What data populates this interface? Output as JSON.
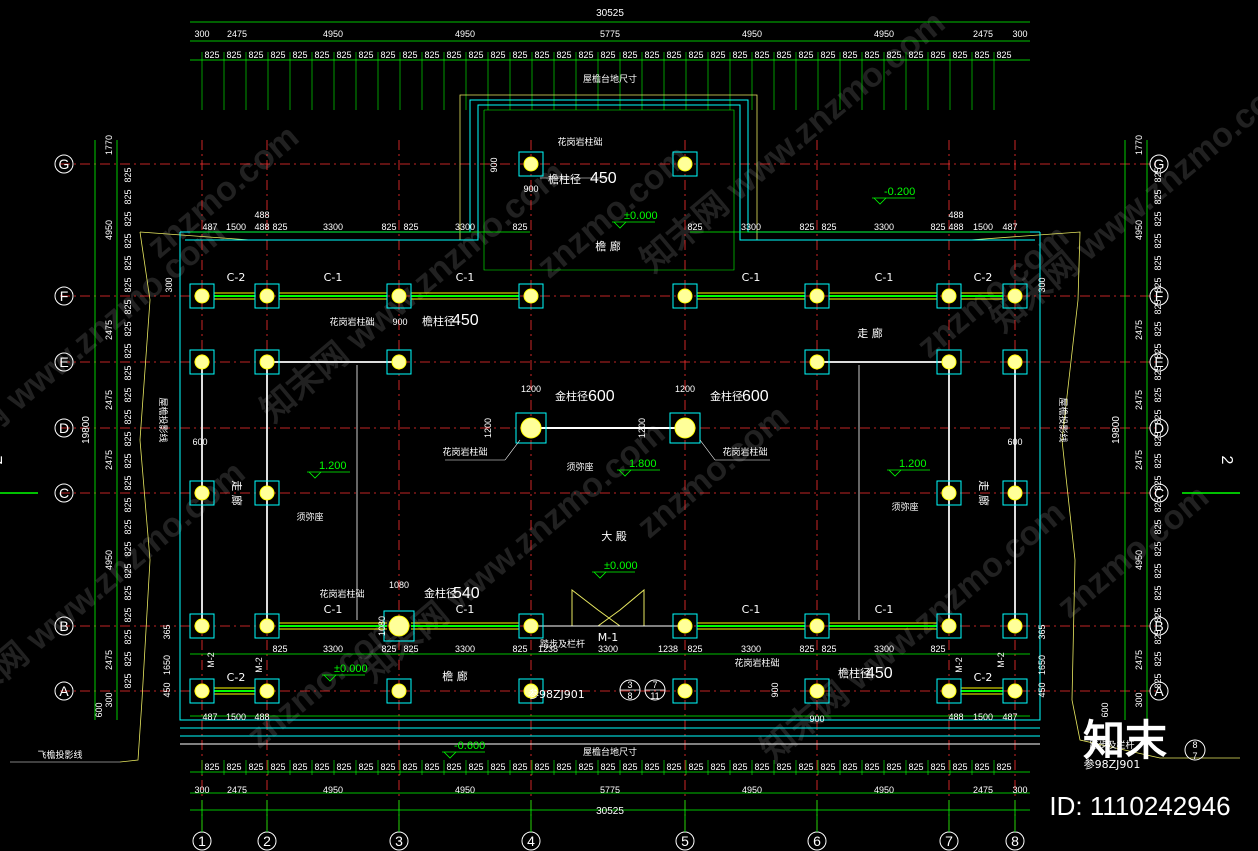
{
  "grid_cols": [
    "1",
    "2",
    "3",
    "4",
    "5",
    "6",
    "7",
    "8"
  ],
  "grid_rows": [
    "G",
    "F",
    "E",
    "D",
    "C",
    "B",
    "A"
  ],
  "dims": {
    "overall": "30525",
    "top_bays": [
      "300",
      "2475",
      "4950",
      "4950",
      "5775",
      "4950",
      "4950",
      "2475",
      "300"
    ],
    "module": "825",
    "left_total": "19800",
    "right_total": "19800",
    "left_rows": [
      "1770",
      "825",
      "4950",
      "825",
      "2475",
      "2475",
      "2475",
      "4950",
      "2475",
      "300",
      "600"
    ],
    "front_rooms": [
      "487",
      "1500",
      "488",
      "825",
      "3300",
      "825",
      "825",
      "3300",
      "825"
    ],
    "bottom_doors": [
      "825",
      "3300",
      "825",
      "825",
      "3300",
      "825",
      "1238",
      "3300",
      "1238",
      "825",
      "3300",
      "825",
      "825",
      "3300",
      "825"
    ],
    "side_small": [
      "365",
      "1650",
      "450",
      "600",
      "300"
    ],
    "col_small": [
      "900",
      "900",
      "1200",
      "1200",
      "1200",
      "1200",
      "1080",
      "1080",
      "900",
      "900"
    ]
  },
  "labels": {
    "column_base_1": "花岗岩柱础",
    "eave_col": "檐柱径",
    "eave_col_size": "450",
    "gold_col": "金柱径",
    "gold_col_size_600": "600",
    "gold_col_size_540": "540",
    "corridor": "走  廊",
    "front_corridor": "檐    廊",
    "hall": "大    殿",
    "altar": "须弥座",
    "window_c1": "C-1",
    "window_c2": "C-2",
    "door_m1": "M-1",
    "door_m2": "M-2",
    "step_ref": "踏步及栏杆",
    "std_ref": "98ZJ901",
    "std_ref_full": "参98ZJ901",
    "roof_outline": "屋檐投影线",
    "roof_line_label": "飞檐投影线",
    "upper_axis": "屋檐台地尺寸",
    "section_mark": "2",
    "detail_nums": [
      "3",
      "7",
      "8",
      "11"
    ]
  },
  "elevations": {
    "e0": "±0.000",
    "e1": "±0.000",
    "e2": "±0.000",
    "e_m200": "-0.200",
    "e_m600": "-0.600",
    "e1200a": "1.200",
    "e1200b": "1.200",
    "e1800": "1.800"
  },
  "watermarks": [
    "知末网 www.znzmo.com",
    "znzmo.com",
    "知末网"
  ],
  "brand": {
    "logo": "知末",
    "id": "ID: 1110242946"
  }
}
